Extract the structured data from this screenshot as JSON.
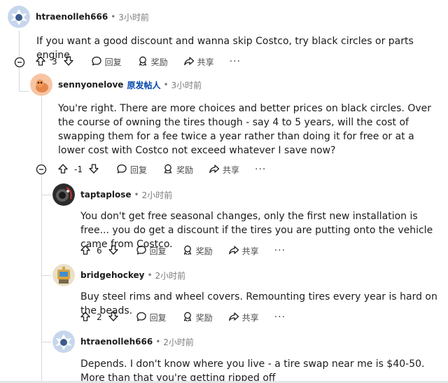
{
  "colors": {
    "op_badge": "#0045ac",
    "text": "#1c1c1c",
    "meta": "#7c7c7c",
    "thread_line": "#d4d7d9"
  },
  "labels": {
    "reply": "回复",
    "award": "奖励",
    "share": "共享",
    "more": "···"
  },
  "comments": [
    {
      "author": "htraenolleh666",
      "op_badge": "",
      "dot": "•",
      "time": "3小时前",
      "text": "If you want a good discount and wanna skip Costco, try black circles or parts engine",
      "votes": "3",
      "avatar_icon": "snoo-avatar-icon"
    },
    {
      "author": "sennyonelove",
      "op_badge": "原发帖人",
      "dot": "•",
      "time": "3小时前",
      "text": "You're right. There are more choices and better prices on black circles. Over the course of owning the tires though - say 4 to 5 years, will the cost of swapping them for a fee twice a year rather than doing it for free or at a lower cost with Costco not exceed whatever I save now?",
      "votes": "-1",
      "avatar_icon": "orange-snoo-avatar-icon"
    },
    {
      "author": "taptaplose",
      "op_badge": "",
      "dot": "•",
      "time": "2小时前",
      "text": "You don't get free seasonal changes, only the first new installation is free... you do get a discount if the tires you are putting onto the vehicle came from Costco.",
      "votes": "6",
      "avatar_icon": "photo-avatar-icon"
    },
    {
      "author": "bridgehockey",
      "op_badge": "",
      "dot": "•",
      "time": "2小时前",
      "text": "Buy steel rims and wheel covers. Remounting tires every year is hard on the beads.",
      "votes": "2",
      "avatar_icon": "robot-avatar-icon"
    },
    {
      "author": "htraenolleh666",
      "op_badge": "",
      "dot": "•",
      "time": "2小时前",
      "text": "Depends. I don't know where you live - a tire swap near me is $40-50. More than that you're getting ripped off",
      "avatar_icon": "snoo-avatar-icon"
    }
  ]
}
